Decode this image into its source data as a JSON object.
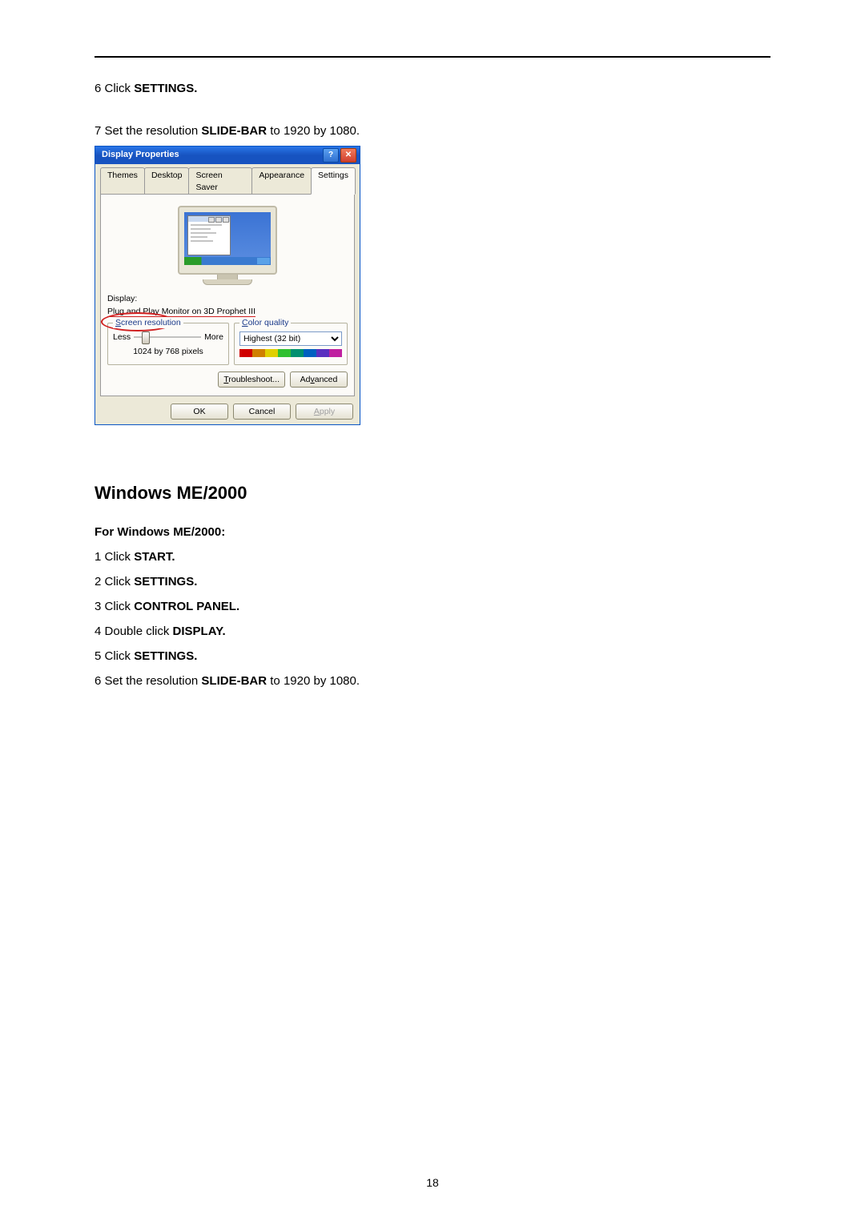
{
  "steps_top": {
    "s6_prefix": "6 Click ",
    "s6_bold": "SETTINGS.",
    "s7_prefix": "7 Set the resolution ",
    "s7_bold": "SLIDE-BAR",
    "s7_suffix": " to 1920 by 1080."
  },
  "dialog": {
    "title": "Display Properties",
    "help_btn": "?",
    "close_btn": "✕",
    "tabs": {
      "themes": "Themes",
      "desktop": "Desktop",
      "screensaver": "Screen Saver",
      "appearance": "Appearance",
      "settings": "Settings"
    },
    "display_label": "Display:",
    "display_value": "Plug and Play Monitor on 3D Prophet III",
    "group_resolution": {
      "label_pre": "S",
      "label_rest": "creen resolution",
      "less": "Less",
      "more": "More",
      "value": "1024 by 768 pixels"
    },
    "group_color": {
      "label_pre": "C",
      "label_rest": "olor quality",
      "dropdown_value": "Highest (32 bit)"
    },
    "panel_buttons": {
      "troubleshoot_u": "T",
      "troubleshoot_rest": "roubleshoot...",
      "advanced_pre": "Ad",
      "advanced_u": "v",
      "advanced_rest": "anced"
    },
    "dlg_buttons": {
      "ok": "OK",
      "cancel": "Cancel",
      "apply_u": "A",
      "apply_rest": "pply"
    }
  },
  "section_heading": "Windows ME/2000",
  "me2000": {
    "intro": "For Windows ME/2000:",
    "s1_prefix": "1 Click ",
    "s1_bold": "START.",
    "s2_prefix": "2 Click ",
    "s2_bold": "SETTINGS.",
    "s3_prefix": "3 Click ",
    "s3_bold": "CONTROL PANEL.",
    "s4_prefix": "4 Double click ",
    "s4_bold": "DISPLAY.",
    "s5_prefix": "5 Click ",
    "s5_bold": "SETTINGS.",
    "s6_prefix": "6 Set the resolution ",
    "s6_bold": "SLIDE-BAR",
    "s6_suffix": " to 1920 by 1080."
  },
  "page_number": "18"
}
